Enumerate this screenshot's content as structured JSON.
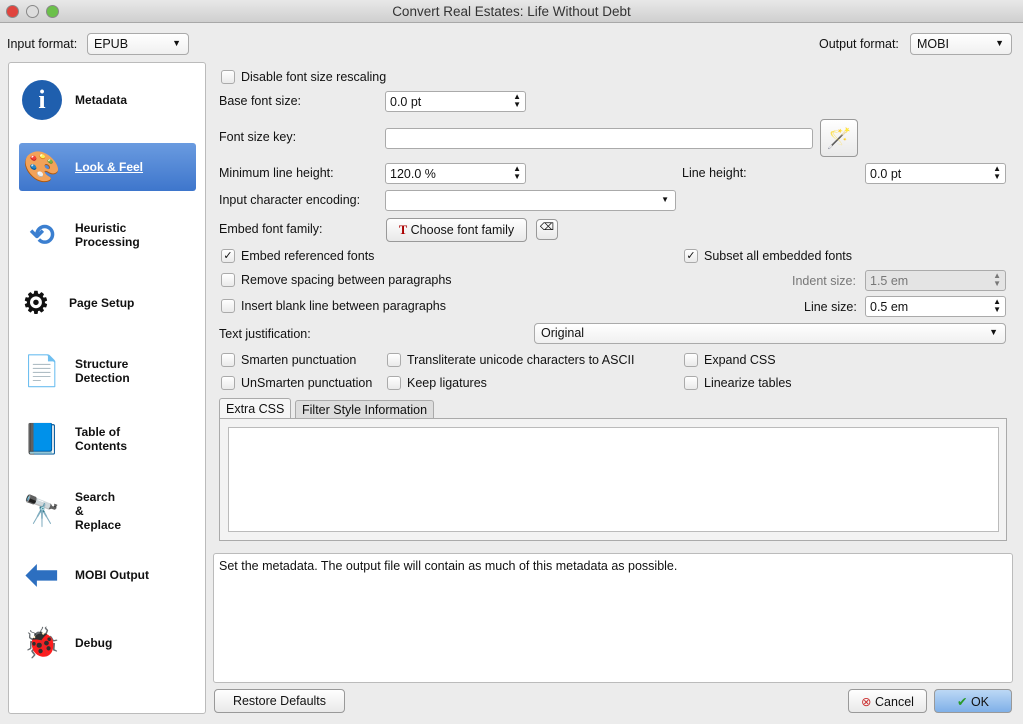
{
  "window": {
    "title": "Convert Real Estates: Life Without Debt"
  },
  "input_format": {
    "label": "Input format:",
    "value": "EPUB"
  },
  "output_format": {
    "label": "Output format:",
    "value": "MOBI"
  },
  "sidebar": {
    "items": [
      {
        "label": "Metadata",
        "icon": "info-icon"
      },
      {
        "label": "Look & Feel",
        "icon": "paint-icon"
      },
      {
        "label": "Heuristic Processing",
        "icon": "heuristic-icon"
      },
      {
        "label": "Page Setup",
        "icon": "gear-icon"
      },
      {
        "label": "Structure Detection",
        "icon": "document-icon"
      },
      {
        "label": "Table of Contents",
        "icon": "notebook-icon"
      },
      {
        "label": "Search & Replace",
        "icon": "binoculars-icon"
      },
      {
        "label": "MOBI Output",
        "icon": "arrow-left-icon"
      },
      {
        "label": "Debug",
        "icon": "ladybug-icon"
      }
    ]
  },
  "form": {
    "disable_rescaling": "Disable font size rescaling",
    "base_font_size_label": "Base font size:",
    "base_font_size": "0.0 pt",
    "font_size_key_label": "Font size key:",
    "font_size_key": "",
    "min_line_height_label": "Minimum line height:",
    "min_line_height": "120.0 %",
    "line_height_label": "Line height:",
    "line_height": "0.0 pt",
    "encoding_label": "Input character encoding:",
    "encoding": "",
    "embed_family_label": "Embed font family:",
    "choose_font": "Choose font family",
    "embed_referenced": "Embed referenced fonts",
    "subset_fonts": "Subset all embedded fonts",
    "remove_spacing": "Remove spacing between paragraphs",
    "indent_size_label": "Indent size:",
    "indent_size": "1.5 em",
    "insert_blank": "Insert blank line between paragraphs",
    "line_size_label": "Line size:",
    "line_size": "0.5 em",
    "justification_label": "Text justification:",
    "justification": "Original",
    "smarten": "Smarten punctuation",
    "transliterate": "Transliterate unicode characters to ASCII",
    "expand_css": "Expand CSS",
    "unsmarten": "UnSmarten punctuation",
    "keep_ligatures": "Keep ligatures",
    "linearize": "Linearize tables"
  },
  "tabs": [
    {
      "label": "Extra CSS"
    },
    {
      "label": "Filter Style Information"
    }
  ],
  "description": "Set the metadata. The output file will contain as much of this metadata as possible.",
  "buttons": {
    "restore": "Restore Defaults",
    "cancel": "Cancel",
    "ok": "OK"
  }
}
